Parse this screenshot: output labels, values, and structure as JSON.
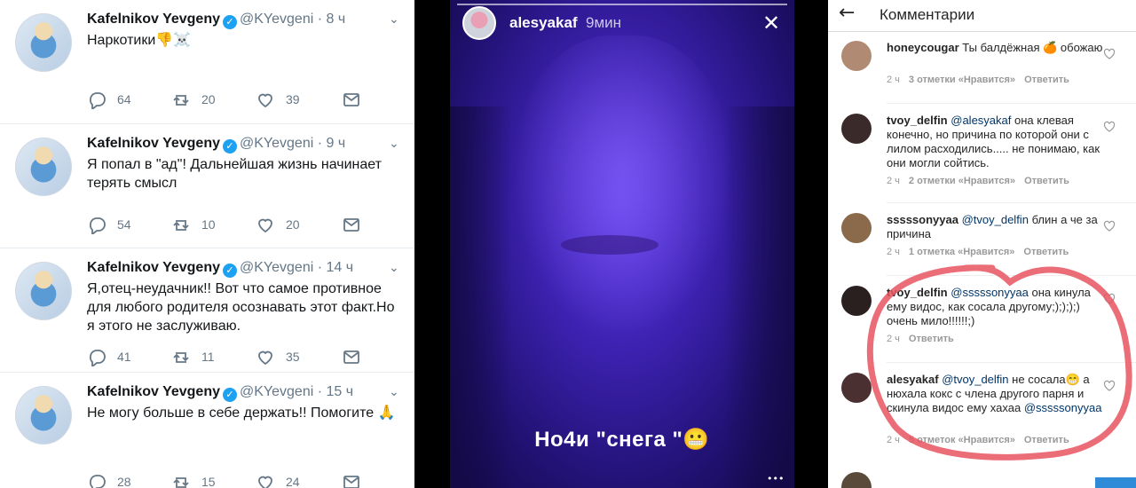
{
  "twitter": {
    "tweets": [
      {
        "name": "Kafelnikov Yevgeny",
        "verified_glyph": "✓",
        "handle": "@KYevgeni",
        "dot": "·",
        "time": "8 ч",
        "text": "Наркотики👎☠️",
        "replies": "64",
        "retweets": "20",
        "likes": "39"
      },
      {
        "name": "Kafelnikov Yevgeny",
        "verified_glyph": "✓",
        "handle": "@KYevgeni",
        "dot": "·",
        "time": "9 ч",
        "text": "Я попал в \"ад\"! Дальнейшая жизнь начинает терять смысл",
        "replies": "54",
        "retweets": "10",
        "likes": "20"
      },
      {
        "name": "Kafelnikov Yevgeny",
        "verified_glyph": "✓",
        "handle": "@KYevgeni",
        "dot": "·",
        "time": "14 ч",
        "text": "Я,отец-неудачник!! Вот что самое противное для любого родителя осознавать этот факт.Но я этого не заслуживаю.",
        "replies": "41",
        "retweets": "11",
        "likes": "35"
      },
      {
        "name": "Kafelnikov Yevgeny",
        "verified_glyph": "✓",
        "handle": "@KYevgeni",
        "dot": "·",
        "time": "15 ч",
        "text": "Не могу больше в себе держать!! Помогите 🙏",
        "replies": "28",
        "retweets": "15",
        "likes": "24"
      }
    ]
  },
  "story": {
    "username": "alesyakaf",
    "age": "9мин",
    "close_glyph": "✕",
    "caption": "Но4и \"снега \"😬",
    "more_glyph": "•••"
  },
  "comments": {
    "back_glyph": "←",
    "title": "Комментарии",
    "items": [
      {
        "user": "honeycougar",
        "mention": "",
        "text": "Ты балдёжная 🍊 обожаю",
        "time": "2 ч",
        "likes": "3 отметки «Нравится»",
        "reply": "Ответить"
      },
      {
        "user": "tvoy_delfin",
        "mention": "@alesyakaf",
        "text": "она клевая конечно, но причина по которой они с лилом расходились..... не понимаю, как они могли сойтись.",
        "time": "2 ч",
        "likes": "2 отметки «Нравится»",
        "reply": "Ответить"
      },
      {
        "user": "sssssonyyaa",
        "mention": "@tvoy_delfin",
        "text": "блин а че за причина",
        "time": "2 ч",
        "likes": "1 отметка «Нравится»",
        "reply": "Ответить"
      },
      {
        "user": "tvoy_delfin",
        "mention": "@sssssonyyaa",
        "text": "она кинула ему видос, как сосала другому;);););) очень мило!!!!!!;)",
        "time": "2 ч",
        "likes": "",
        "reply": "Ответить"
      },
      {
        "user": "alesyakaf",
        "mention": "@tvoy_delfin",
        "text": "не сосала😁 а нюхала кокс с члена другого парня и скинула видос ему хахаа",
        "mention2": "@sssssonyyaa",
        "time": "2 ч",
        "likes": "5 отметок «Нравится»",
        "reply": "Ответить"
      }
    ]
  },
  "colors": {
    "twitter_blue": "#1da1f2",
    "muted": "#657786",
    "annotation_red": "#e8545f",
    "story_purple": "#4a2bd0"
  }
}
